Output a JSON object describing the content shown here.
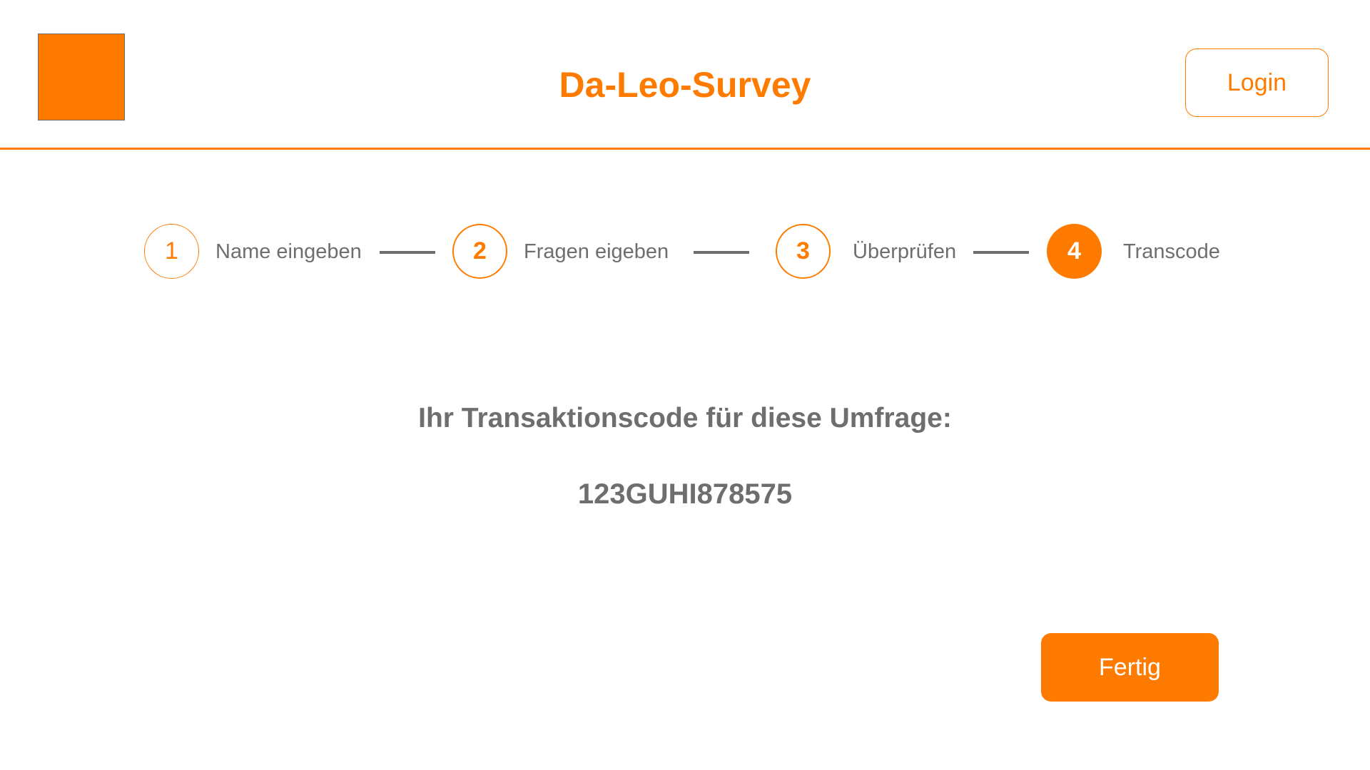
{
  "header": {
    "title": "Da-Leo-Survey",
    "login_label": "Login"
  },
  "stepper": {
    "steps": [
      {
        "number": "1",
        "label": "Name eingeben"
      },
      {
        "number": "2",
        "label": "Fragen eigeben"
      },
      {
        "number": "3",
        "label": "Überprüfen"
      },
      {
        "number": "4",
        "label": "Transcode"
      }
    ],
    "active_step": 4
  },
  "main": {
    "heading": "Ihr Transaktionscode für diese Umfrage:",
    "transaction_code": "123GUHI878575",
    "finish_label": "Fertig"
  },
  "colors": {
    "accent": "#ff7b00",
    "text": "#6e6e6e",
    "background": "#ffffff"
  }
}
